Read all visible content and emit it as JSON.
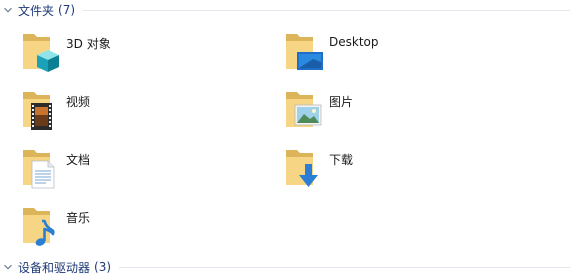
{
  "groups": {
    "folders": {
      "title": "文件夹",
      "count": "(7)"
    },
    "devices": {
      "title": "设备和驱动器",
      "count": "(3)"
    }
  },
  "items": [
    {
      "label": "3D 对象",
      "icon": "3d-objects-icon"
    },
    {
      "label": "Desktop",
      "icon": "desktop-folder-icon"
    },
    {
      "label": "视频",
      "icon": "videos-folder-icon"
    },
    {
      "label": "图片",
      "icon": "pictures-folder-icon"
    },
    {
      "label": "文档",
      "icon": "documents-folder-icon"
    },
    {
      "label": "下载",
      "icon": "downloads-folder-icon"
    },
    {
      "label": "音乐",
      "icon": "music-folder-icon"
    }
  ],
  "colors": {
    "folder_back": "#dcb55b",
    "folder_front": "#f6d684",
    "header_text": "#1e3a78",
    "accent_blue": "#2a7fd4"
  }
}
